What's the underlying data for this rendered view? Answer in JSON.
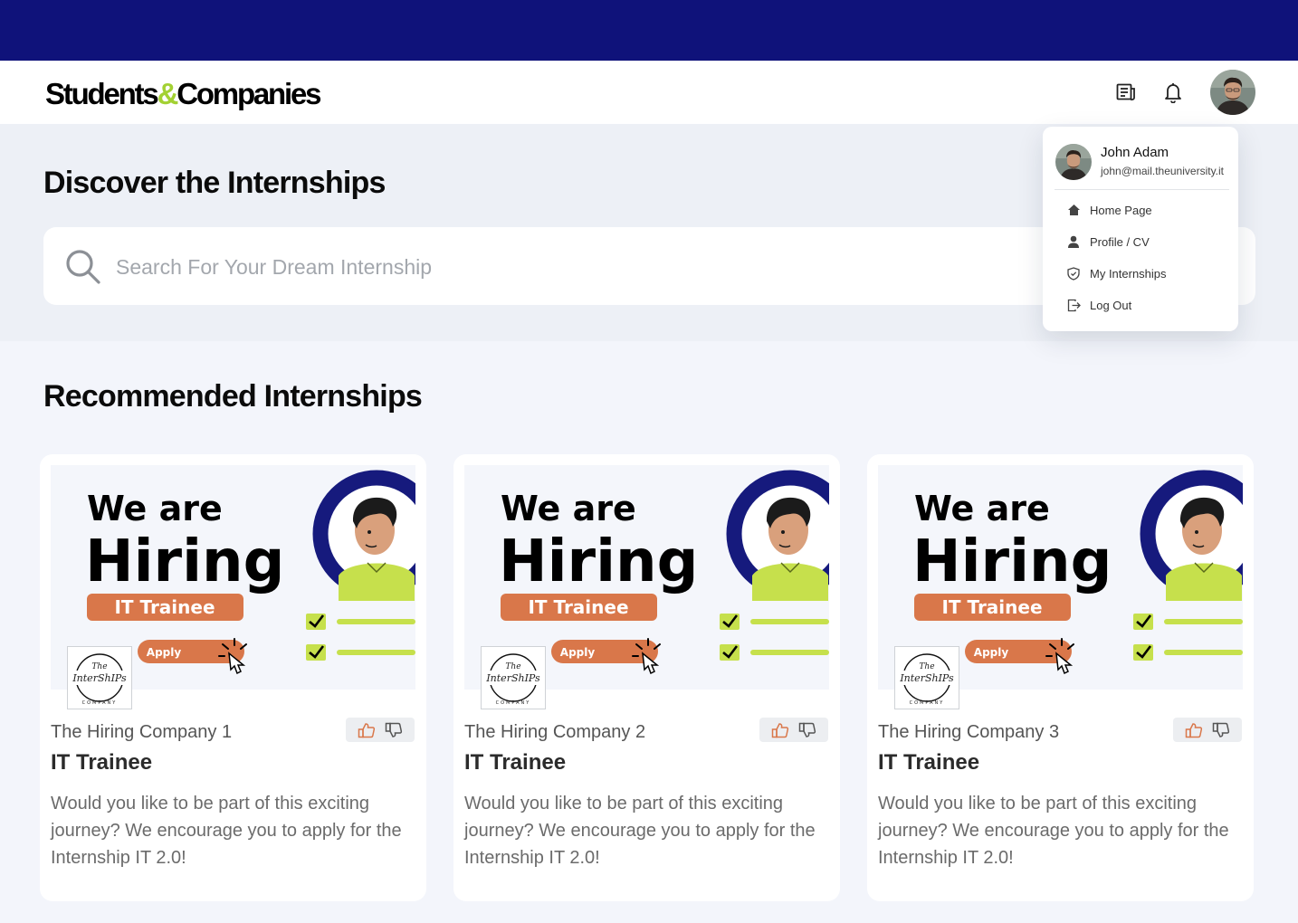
{
  "brand": {
    "part1": "Students",
    "amp": "&",
    "part2": "Companies",
    "accent_color": "#a3d133",
    "nav_color": "#0f127a"
  },
  "header": {
    "icons": [
      "newspaper-icon",
      "bell-icon",
      "user-avatar"
    ]
  },
  "hero": {
    "title": "Discover the Internships",
    "search_placeholder": "Search For Your Dream Internship"
  },
  "recommended": {
    "title": "Recommended Internships",
    "banner": {
      "line1": "We are",
      "line2": "Hiring",
      "role": "IT Trainee",
      "apply": "Apply",
      "logo_the": "The",
      "logo_script": "InterShIPs",
      "logo_company": "COMPANY"
    },
    "cards": [
      {
        "company": "The Hiring Company 1",
        "title": "IT Trainee",
        "description": "Would you like to be part of this exciting journey? We encourage you to apply for the Internship IT 2.0!"
      },
      {
        "company": "The Hiring Company 2",
        "title": "IT Trainee",
        "description": "Would you like to be part of this exciting journey? We encourage you to apply for the Internship IT 2.0!"
      },
      {
        "company": "The Hiring Company 3",
        "title": "IT Trainee",
        "description": "Would you like to be part of this exciting journey? We encourage you to apply for the Internship IT 2.0!"
      }
    ]
  },
  "user_menu": {
    "name": "John Adam",
    "email": "john@mail.theuniversity.it",
    "items": [
      {
        "label": "Home Page",
        "icon": "home-icon"
      },
      {
        "label": "Profile / CV",
        "icon": "user-icon"
      },
      {
        "label": "My Internships",
        "icon": "shield-icon"
      },
      {
        "label": "Log Out",
        "icon": "logout-icon"
      }
    ]
  }
}
